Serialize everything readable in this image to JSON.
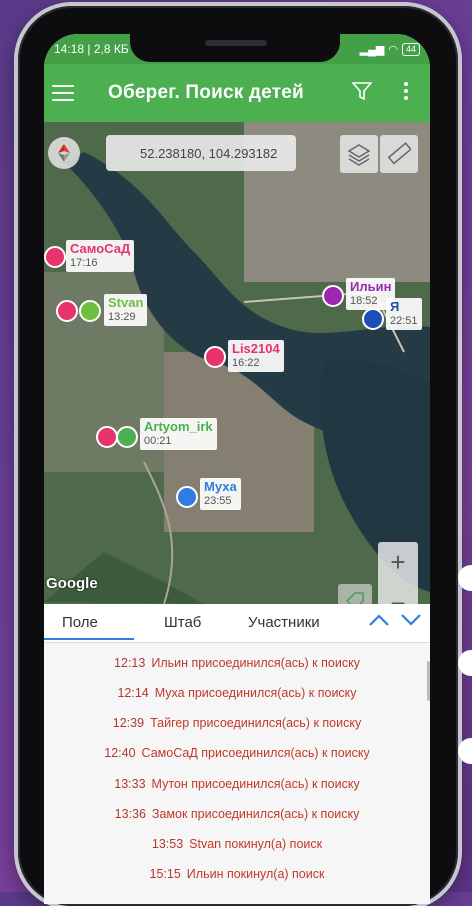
{
  "status": {
    "time_info": "14:18 | 2,8 КБ",
    "battery": "44"
  },
  "app": {
    "title": "Оберег. Поиск детей"
  },
  "map": {
    "coordinates": "52.238180, 104.293182",
    "attribution": "Google",
    "zoom_in": "+",
    "zoom_out": "−",
    "markers": [
      {
        "name": "СамоСаД",
        "time": "17:16",
        "color": "#e8336d"
      },
      {
        "name": "Stvan",
        "time": "13:29",
        "color": "#6cbf3f"
      },
      {
        "name": "Ильин",
        "time": "18:52",
        "color": "#9c27b0"
      },
      {
        "name": "Я",
        "time": "22:51",
        "color": "#1e4fb8"
      },
      {
        "name": "Lis2104",
        "time": "16:22",
        "color": "#e8336d"
      },
      {
        "name": "Artyom_irk",
        "time": "00:21",
        "color": "#4caf50"
      },
      {
        "name": "Муха",
        "time": "23:55",
        "color": "#2f7de1"
      }
    ]
  },
  "tabs": [
    "Поле",
    "Штаб",
    "Участники"
  ],
  "log": [
    {
      "time": "12:13",
      "text": "Ильин присоединился(ась) к поиску"
    },
    {
      "time": "12:14",
      "text": "Муха присоединился(ась) к поиску"
    },
    {
      "time": "12:39",
      "text": "Тайгер присоединился(ась) к поиску"
    },
    {
      "time": "12:40",
      "text": "СамоСаД присоединился(ась) к поиску"
    },
    {
      "time": "13:33",
      "text": "Мутон присоединился(ась) к поиску"
    },
    {
      "time": "13:36",
      "text": "Замок присоединился(ась) к поиску"
    },
    {
      "time": "13:53",
      "text": "Stvan покинул(а) поиск"
    },
    {
      "time": "15:15",
      "text": "Ильин покинул(а) поиск"
    }
  ]
}
